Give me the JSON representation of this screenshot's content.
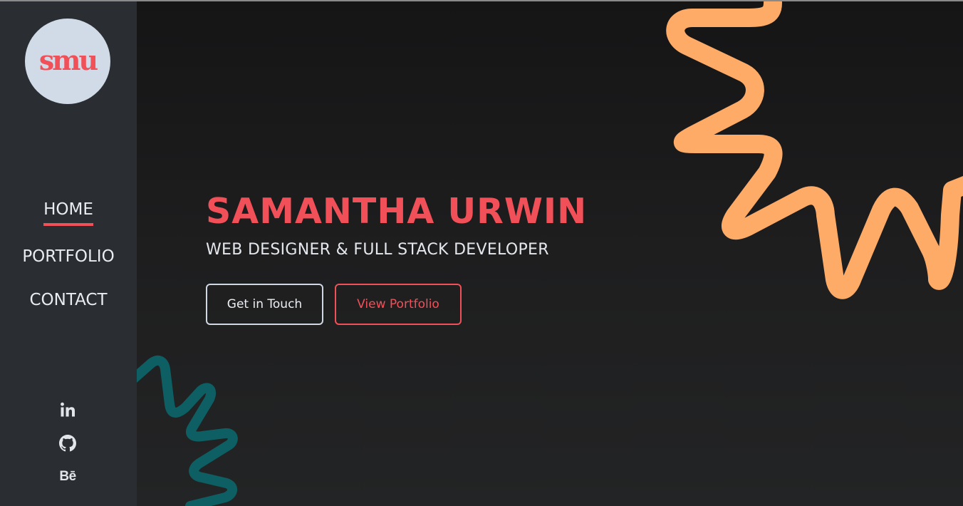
{
  "sidebar": {
    "logo_text": "smu",
    "nav": [
      {
        "label": "HOME",
        "active": true
      },
      {
        "label": "PORTFOLIO",
        "active": false
      },
      {
        "label": "CONTACT",
        "active": false
      }
    ],
    "socials": [
      {
        "icon": "linkedin-icon",
        "label": "in"
      },
      {
        "icon": "github-icon"
      },
      {
        "icon": "behance-icon",
        "label": "Bē"
      }
    ]
  },
  "hero": {
    "name": "SAMANTHA URWIN",
    "role": "WEB DESIGNER & FULL STACK DEVELOPER",
    "primary_button": "Get in Touch",
    "secondary_button": "View Portfolio"
  },
  "colors": {
    "accent": "#f25058",
    "sidebar_bg": "#2a2d31",
    "main_bg": "#1b1b1c",
    "logo_bg": "#d0dbe7",
    "squiggle_orange": "#ffab68",
    "squiggle_teal": "#0e5f63",
    "text_light": "#e4e8ed"
  }
}
